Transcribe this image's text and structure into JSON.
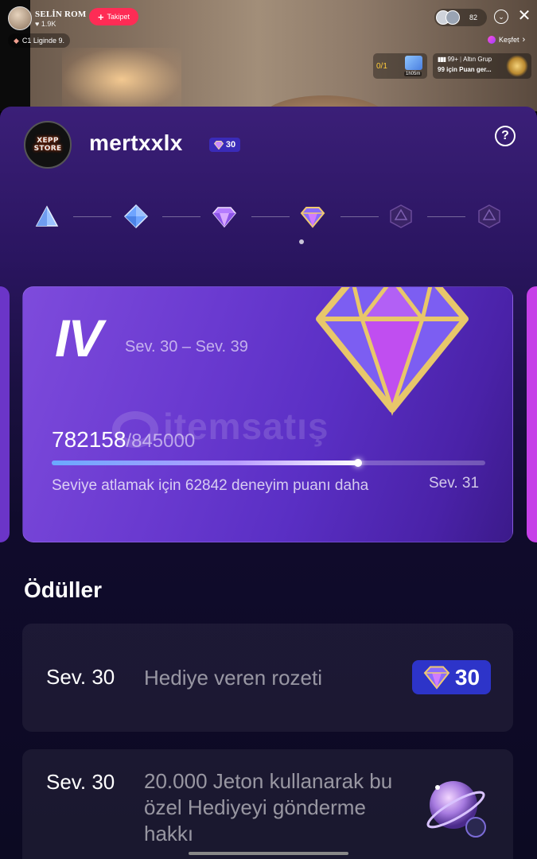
{
  "stream": {
    "host_name": "SELİN ROM",
    "host_likes": "1.9K",
    "follow_label": "Takipet",
    "league_label": "C1 Liginde 9.",
    "viewer_count": "82",
    "explore_label": "Keşfet",
    "goal_progress": "0/1",
    "goal_timer": "1h05m",
    "rank_count": "99+",
    "rank_group": "Altın Grup",
    "rank_cta": "99 için Puan ger..."
  },
  "profile": {
    "avatar_text": "XEPP STORE",
    "username": "mertxxlx",
    "level": "30"
  },
  "tiers": {
    "icons": [
      "tier-1-icon",
      "tier-2-icon",
      "tier-3-icon",
      "tier-4-icon",
      "tier-5-locked-icon",
      "tier-6-locked-icon"
    ],
    "active_index": 3
  },
  "level_card": {
    "tier_roman": "IV",
    "level_range": "Sev. 30 – Sev. 39",
    "watermark_text": "itemsatış",
    "xp_current": "782158",
    "xp_max": "/845000",
    "progress_fraction": 0.7107,
    "note": "Seviye atlamak için 62842 deneyim puanı daha",
    "next_level": "Sev. 31"
  },
  "rewards": {
    "title": "Ödüller",
    "items": [
      {
        "level": "Sev. 30",
        "description": "Hediye veren rozeti",
        "badge_value": "30"
      },
      {
        "level": "Sev. 30",
        "description": "20.000 Jeton kullanarak bu özel Hediyeyi gönderme hakkı"
      }
    ]
  },
  "colors": {
    "accent_red": "#fe2c55",
    "badge_blue": "#2d34c9",
    "card_purple": "#6a3ad0",
    "gem_gold": "#e8c76a"
  }
}
